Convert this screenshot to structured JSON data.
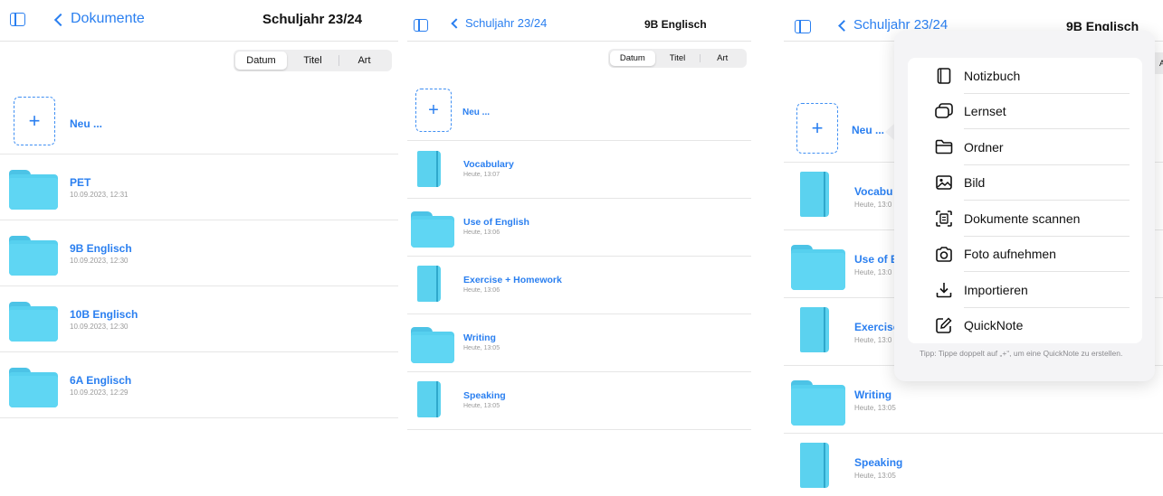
{
  "panel1": {
    "back_label": "Dokumente",
    "title": "Schuljahr 23/24",
    "sort_options": [
      "Datum",
      "Titel",
      "Art"
    ],
    "new_label": "Neu ...",
    "items": [
      {
        "name": "PET",
        "date": "10.09.2023, 12:31",
        "kind": "folder"
      },
      {
        "name": "9B Englisch",
        "date": "10.09.2023, 12:30",
        "kind": "folder"
      },
      {
        "name": "10B Englisch",
        "date": "10.09.2023, 12:30",
        "kind": "folder"
      },
      {
        "name": "6A Englisch",
        "date": "10.09.2023, 12:29",
        "kind": "folder"
      }
    ]
  },
  "panel2": {
    "back_label": "Schuljahr 23/24",
    "title": "9B Englisch",
    "sort_options": [
      "Datum",
      "Titel",
      "Art"
    ],
    "new_label": "Neu ...",
    "items": [
      {
        "name": "Vocabulary",
        "date": "Heute, 13:07",
        "kind": "notebook"
      },
      {
        "name": "Use of English",
        "date": "Heute, 13:06",
        "kind": "folder"
      },
      {
        "name": "Exercise + Homework",
        "date": "Heute, 13:06",
        "kind": "notebook"
      },
      {
        "name": "Writing",
        "date": "Heute, 13:05",
        "kind": "folder"
      },
      {
        "name": "Speaking",
        "date": "Heute, 13:05",
        "kind": "notebook"
      }
    ]
  },
  "panel3": {
    "back_label": "Schuljahr 23/24",
    "title": "9B Englisch",
    "sort_partial": "Ar",
    "new_label": "Neu ...",
    "items": [
      {
        "name": "Vocabu",
        "date": "Heute, 13:0",
        "kind": "notebook"
      },
      {
        "name": "Use of E",
        "date": "Heute, 13:0",
        "kind": "folder"
      },
      {
        "name": "Exercise",
        "date": "Heute, 13:0",
        "kind": "notebook"
      },
      {
        "name": "Writing",
        "date": "Heute, 13:05",
        "kind": "folder"
      },
      {
        "name": "Speaking",
        "date": "Heute, 13:05",
        "kind": "notebook"
      }
    ]
  },
  "menu": {
    "items": [
      {
        "label": "Notizbuch",
        "icon": "notebook-icon"
      },
      {
        "label": "Lernset",
        "icon": "flashcards-icon"
      },
      {
        "label": "Ordner",
        "icon": "folder-icon"
      },
      {
        "label": "Bild",
        "icon": "image-icon"
      },
      {
        "label": "Dokumente scannen",
        "icon": "scan-icon"
      },
      {
        "label": "Foto aufnehmen",
        "icon": "camera-icon"
      },
      {
        "label": "Importieren",
        "icon": "import-icon"
      },
      {
        "label": "QuickNote",
        "icon": "quicknote-icon"
      }
    ],
    "hint": "Tipp: Tippe doppelt auf „+“, um eine QuickNote zu erstellen."
  },
  "colors": {
    "accent": "#2a7ff0",
    "folder": "#56d0ef",
    "notebook": "#5bd2ef"
  }
}
